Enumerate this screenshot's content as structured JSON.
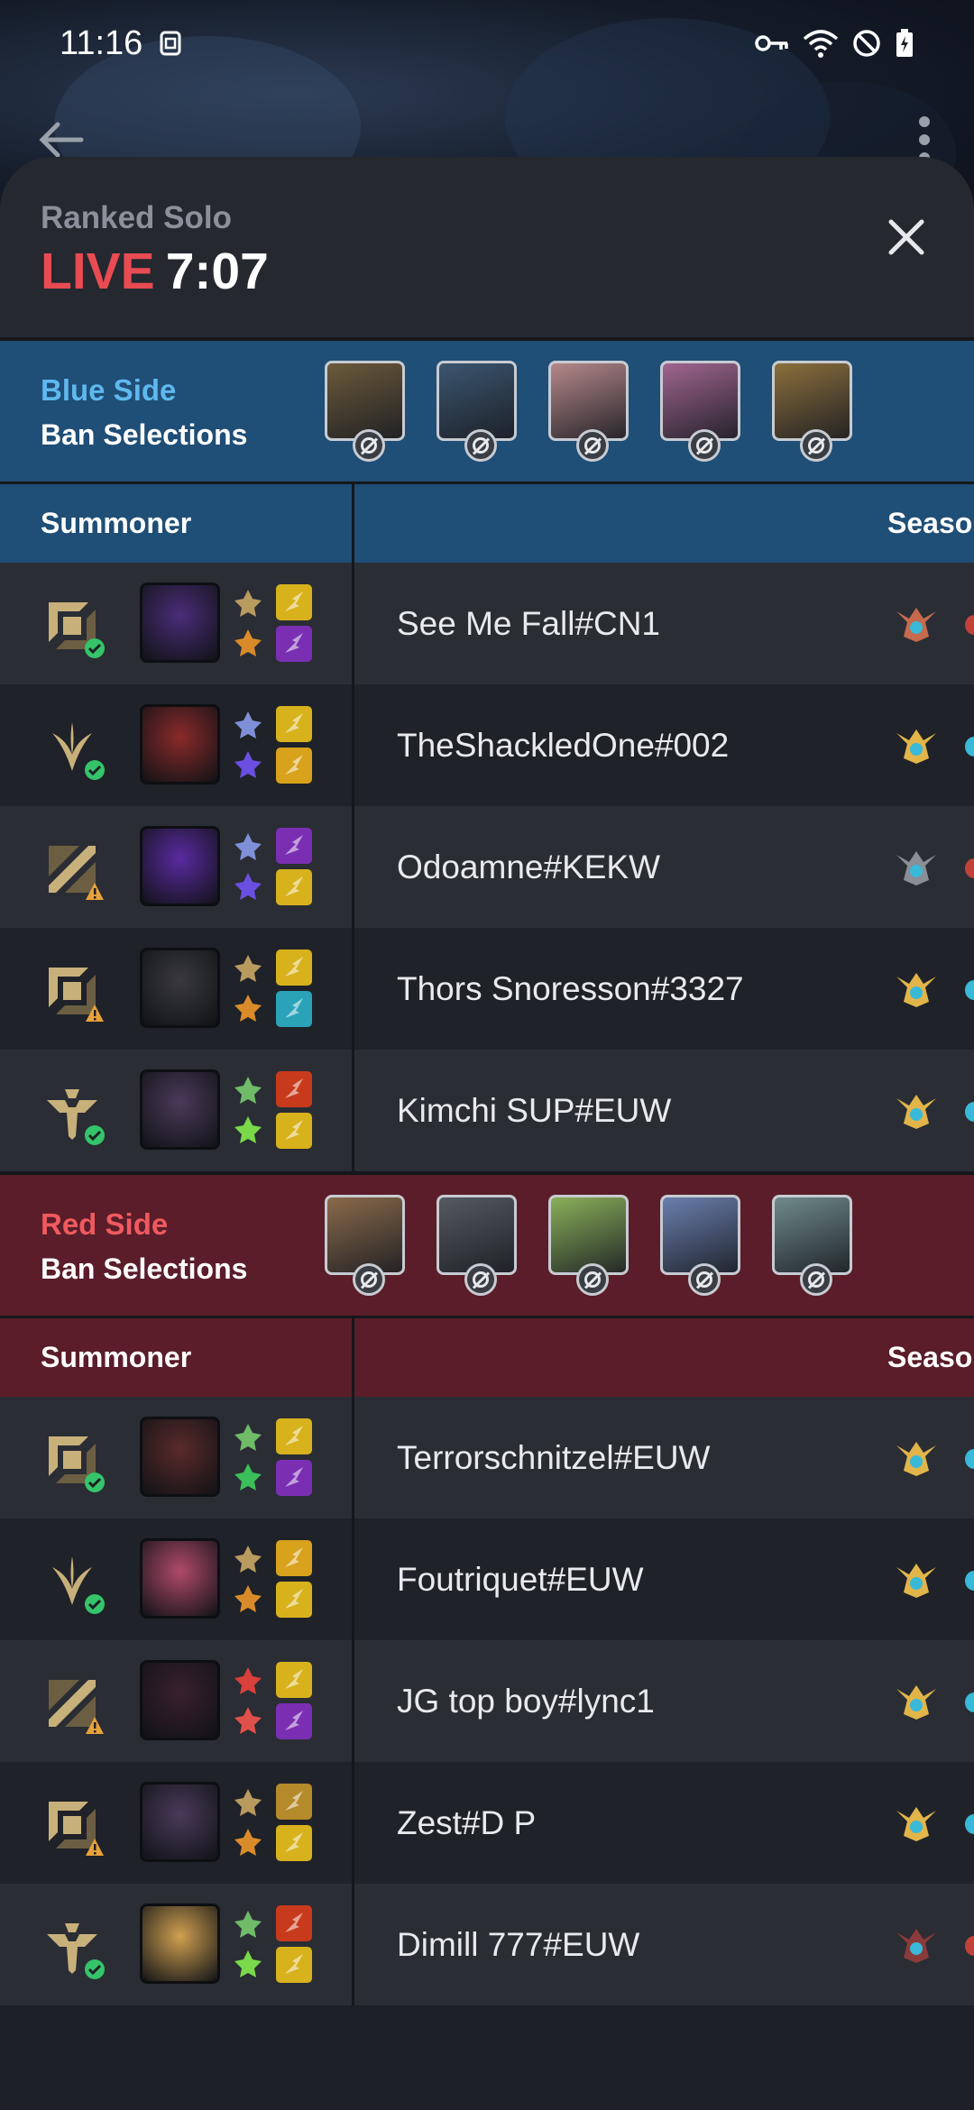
{
  "status": {
    "time": "11:16",
    "icons": [
      "sim-icon",
      "vpn-key-icon",
      "wifi-icon",
      "dnd-icon",
      "battery-icon"
    ]
  },
  "nav": {
    "back_icon": "back-arrow-icon",
    "menu_icon": "more-vert-icon"
  },
  "header": {
    "queue": "Ranked Solo",
    "live_label": "LIVE",
    "clock": "7:07",
    "close_icon": "close-icon"
  },
  "blue": {
    "side": "Blue Side",
    "ban_label": "Ban Selections",
    "bans": [
      "#6b5a3a",
      "#3b5670",
      "#b5888a",
      "#a0658f",
      "#8b6f3c"
    ],
    "col_summoner": "Summoner",
    "col_season": "Season",
    "players": [
      {
        "name": "See Me Fall#CN1",
        "role": "top",
        "status": "ok",
        "champ": "#4a2d78",
        "rune1": "#b99a5f",
        "rune2": "#d98b2a",
        "spell1": "#d8b21c",
        "spell2": "#7a2fb3",
        "rank": "#c56a4c",
        "edge": "#c0433b"
      },
      {
        "name": "TheShackledOne#002",
        "role": "jungle",
        "status": "ok",
        "champ": "#8a2a2a",
        "rune1": "#7f8fd8",
        "rune2": "#6a4fe0",
        "spell1": "#d8b21c",
        "spell2": "#d8a21c",
        "rank": "#e2b54a",
        "edge": "#3ab8d8"
      },
      {
        "name": "Odoamne#KEKW",
        "role": "mid",
        "status": "warn",
        "champ": "#5a2aa0",
        "rune1": "#7f8fd8",
        "rune2": "#6a4fe0",
        "spell1": "#7a2fb3",
        "spell2": "#d8b21c",
        "rank": "#8a8e96",
        "edge": "#c0433b"
      },
      {
        "name": "Thors Snoresson#3327",
        "role": "top",
        "status": "warn",
        "champ": "#3a3a3e",
        "rune1": "#b99a5f",
        "rune2": "#d98b2a",
        "spell1": "#d8b21c",
        "spell2": "#2aa3b8",
        "rank": "#e2b54a",
        "edge": "#3ab8d8"
      },
      {
        "name": "Kimchi SUP#EUW",
        "role": "support",
        "status": "ok",
        "champ": "#4b3a5a",
        "rune1": "#6fbb68",
        "rune2": "#7ad84a",
        "spell1": "#c83a1c",
        "spell2": "#d8b21c",
        "rank": "#e2b54a",
        "edge": "#3ab8d8"
      }
    ]
  },
  "red": {
    "side": "Red Side",
    "ban_label": "Ban Selections",
    "bans": [
      "#8a6a4a",
      "#555a60",
      "#8ab05a",
      "#6a7fae",
      "#6f8a8a"
    ],
    "col_summoner": "Summoner",
    "col_season": "Season",
    "players": [
      {
        "name": "Terrorschnitzel#EUW",
        "role": "top",
        "status": "ok",
        "champ": "#5a2a2a",
        "rune1": "#6fbb68",
        "rune2": "#3bbf5a",
        "spell1": "#d8b21c",
        "spell2": "#7a2fb3",
        "rank": "#e2b54a",
        "edge": "#3ab8d8"
      },
      {
        "name": "Foutriquet#EUW",
        "role": "jungle",
        "status": "ok",
        "champ": "#b04a6a",
        "rune1": "#b99a5f",
        "rune2": "#d98b2a",
        "spell1": "#d8a21c",
        "spell2": "#d8b21c",
        "rank": "#e2b54a",
        "edge": "#3ab8d8"
      },
      {
        "name": "JG top boy#lync1",
        "role": "mid",
        "status": "warn",
        "champ": "#3a2030",
        "rune1": "#d8403a",
        "rune2": "#e0504a",
        "spell1": "#d8b21c",
        "spell2": "#7a2fb3",
        "rank": "#e2b54a",
        "edge": "#3ab8d8"
      },
      {
        "name": "Zest#D P",
        "role": "top",
        "status": "warn",
        "champ": "#4a3a5a",
        "rune1": "#b99a5f",
        "rune2": "#d98b2a",
        "spell1": "#b58a2a",
        "spell2": "#d8b21c",
        "rank": "#e2b54a",
        "edge": "#3ab8d8"
      },
      {
        "name": "Dimill 777#EUW",
        "role": "support",
        "status": "ok",
        "champ": "#d0a050",
        "rune1": "#6fbb68",
        "rune2": "#7ad84a",
        "spell1": "#c83a1c",
        "spell2": "#d8b21c",
        "rank": "#8a3a3a",
        "edge": "#c0433b"
      }
    ]
  }
}
